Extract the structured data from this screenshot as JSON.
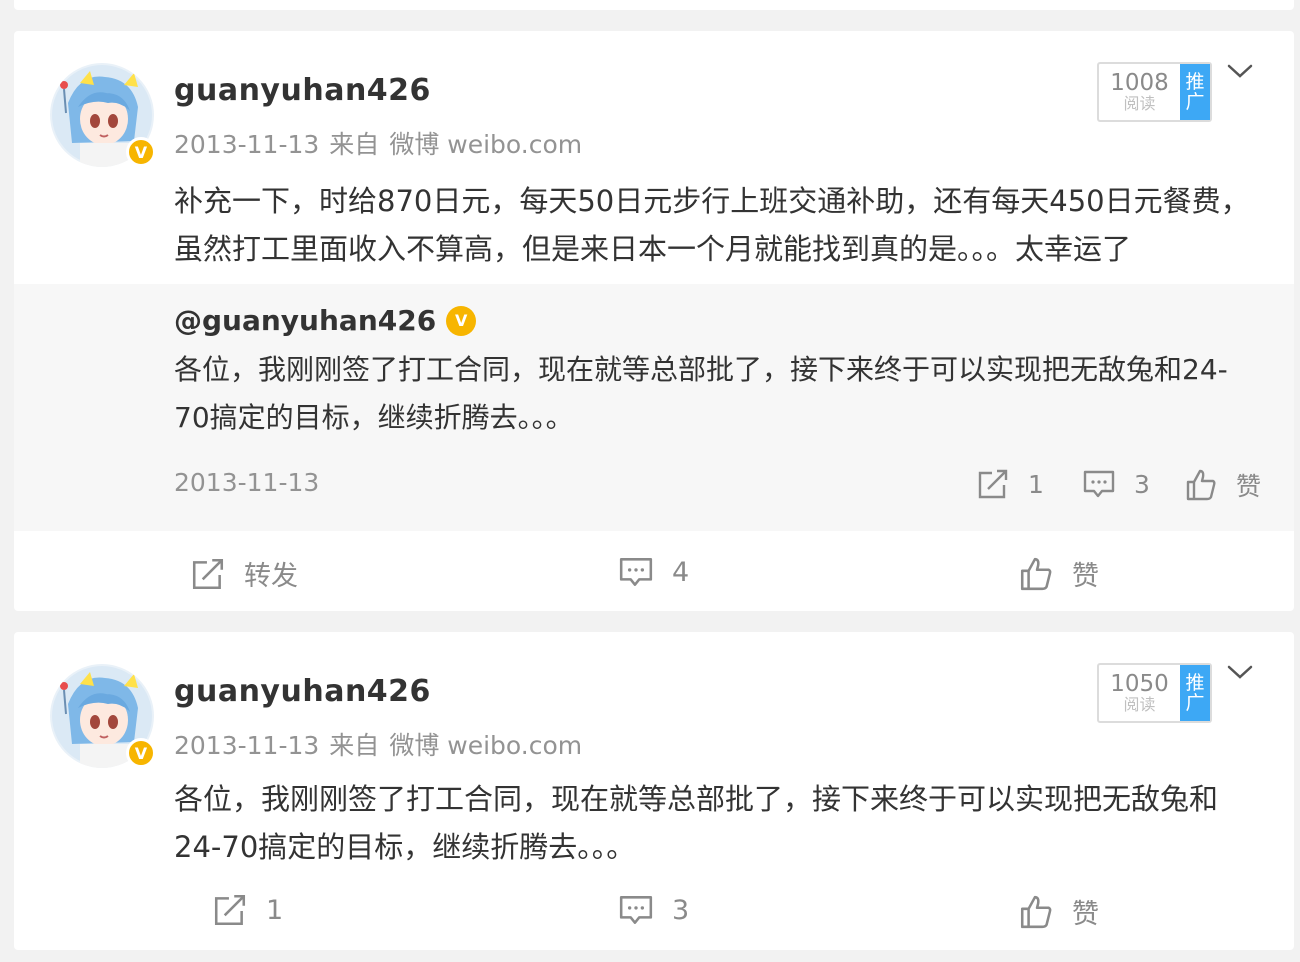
{
  "posts": [
    {
      "username": "guanyuhan426",
      "date": "2013-11-13",
      "source_prefix": "来自",
      "source": "微博 weibo.com",
      "reads": "1008",
      "reads_label": "阅读",
      "promo": "推广",
      "verified_badge": "V",
      "text": "补充一下，时给870日元，每天50日元步行上班交通补助，还有每天450日元餐费，虽然打工里面收入不算高，但是来日本一个月就能找到真的是。。。太幸运了",
      "quote": {
        "username": "@guanyuhan426",
        "text": "各位，我刚刚签了打工合同，现在就等总部批了，接下来终于可以实现把无敌兔和24-70搞定的目标，继续折腾去。。。",
        "date": "2013-11-13",
        "reposts": "1",
        "comments": "3",
        "like_label": "赞"
      },
      "repost_label": "转发",
      "comments": "4",
      "like_label": "赞"
    },
    {
      "username": "guanyuhan426",
      "date": "2013-11-13",
      "source_prefix": "来自",
      "source": "微博 weibo.com",
      "reads": "1050",
      "reads_label": "阅读",
      "promo": "推广",
      "verified_badge": "V",
      "text": "各位，我刚刚签了打工合同，现在就等总部批了，接下来终于可以实现把无敌兔和24-70搞定的目标，继续折腾去。。。",
      "reposts": "1",
      "comments": "3",
      "like_label": "赞"
    }
  ],
  "icons": {
    "repost": "repost-icon",
    "comment": "comment-icon",
    "like": "like-icon",
    "more": "chevron-down-icon",
    "verified": "verified-icon"
  },
  "colors": {
    "verified": "#f7b500",
    "promo": "#3da8f5",
    "muted_text": "#939393"
  }
}
